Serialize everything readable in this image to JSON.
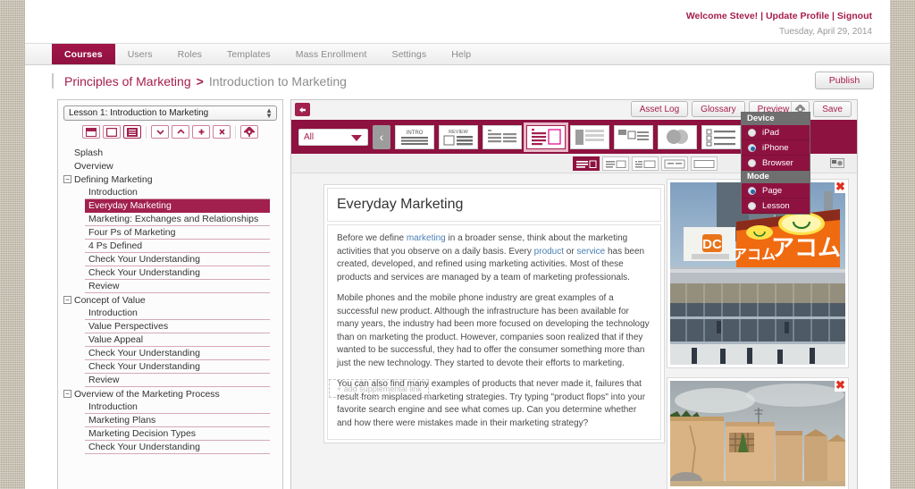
{
  "header": {
    "welcome": "Welcome Steve!",
    "update_profile": "Update Profile",
    "signout": "Signout",
    "sep": " | ",
    "date": "Tuesday, April 29, 2014"
  },
  "nav": {
    "tabs": [
      {
        "label": "Courses",
        "active": true
      },
      {
        "label": "Users",
        "active": false
      },
      {
        "label": "Roles",
        "active": false
      },
      {
        "label": "Templates",
        "active": false
      },
      {
        "label": "Mass Enrollment",
        "active": false
      },
      {
        "label": "Settings",
        "active": false
      },
      {
        "label": "Help",
        "active": false
      }
    ]
  },
  "breadcrumb": {
    "course": "Principles of Marketing",
    "separator": ">",
    "lesson": "Introduction to Marketing",
    "publish_label": "Publish"
  },
  "tree": {
    "lesson_select": "Lesson 1: Introduction to Marketing",
    "tools": [
      {
        "name": "page-layout-icon",
        "selected": false
      },
      {
        "name": "blank-page-icon",
        "selected": false
      },
      {
        "name": "content-page-icon",
        "selected": true
      },
      {
        "name": "move-down-icon",
        "selected": false
      },
      {
        "name": "move-up-icon",
        "selected": false
      },
      {
        "name": "add-icon",
        "selected": false
      },
      {
        "name": "delete-icon",
        "selected": false
      },
      {
        "name": "settings-gear-icon",
        "selected": false
      }
    ],
    "nodes": [
      {
        "label": "Splash",
        "level": 0,
        "group": false,
        "selected": false
      },
      {
        "label": "Overview",
        "level": 0,
        "group": false,
        "selected": false
      },
      {
        "label": "Defining Marketing",
        "level": 0,
        "group": true,
        "selected": false
      },
      {
        "label": "Introduction",
        "level": 1,
        "group": false,
        "selected": false
      },
      {
        "label": "Everyday Marketing",
        "level": 1,
        "group": false,
        "selected": true
      },
      {
        "label": "Marketing: Exchanges and Relationships",
        "level": 1,
        "group": false,
        "selected": false
      },
      {
        "label": "Four Ps of Marketing",
        "level": 1,
        "group": false,
        "selected": false
      },
      {
        "label": "4 Ps Defined",
        "level": 1,
        "group": false,
        "selected": false
      },
      {
        "label": "Check Your Understanding",
        "level": 1,
        "group": false,
        "selected": false
      },
      {
        "label": "Check Your Understanding",
        "level": 1,
        "group": false,
        "selected": false
      },
      {
        "label": "Review",
        "level": 1,
        "group": false,
        "selected": false
      },
      {
        "label": "Concept of Value",
        "level": 0,
        "group": true,
        "selected": false
      },
      {
        "label": "Introduction",
        "level": 1,
        "group": false,
        "selected": false
      },
      {
        "label": "Value Perspectives",
        "level": 1,
        "group": false,
        "selected": false
      },
      {
        "label": "Value Appeal",
        "level": 1,
        "group": false,
        "selected": false
      },
      {
        "label": "Check Your Understanding",
        "level": 1,
        "group": false,
        "selected": false
      },
      {
        "label": "Check Your Understanding",
        "level": 1,
        "group": false,
        "selected": false
      },
      {
        "label": "Review",
        "level": 1,
        "group": false,
        "selected": false
      },
      {
        "label": "Overview of the Marketing Process",
        "level": 0,
        "group": true,
        "selected": false
      },
      {
        "label": "Introduction",
        "level": 1,
        "group": false,
        "selected": false
      },
      {
        "label": "Marketing Plans",
        "level": 1,
        "group": false,
        "selected": false
      },
      {
        "label": "Marketing Decision Types",
        "level": 1,
        "group": false,
        "selected": false
      },
      {
        "label": "Check Your Understanding",
        "level": 1,
        "group": false,
        "selected": false
      }
    ]
  },
  "editor": {
    "actions": {
      "asset_log": "Asset Log",
      "glossary": "Glossary",
      "preview": "Preview",
      "save": "Save"
    },
    "filter_value": "All",
    "templates": [
      {
        "name": "template-intro",
        "label": "INTRO",
        "selected": false
      },
      {
        "name": "template-review",
        "label": "REVIEW",
        "selected": false
      },
      {
        "name": "template-two-column-text",
        "label": "",
        "selected": false
      },
      {
        "name": "template-text-image",
        "label": "",
        "selected": true
      },
      {
        "name": "template-sidebar",
        "label": "",
        "selected": false
      },
      {
        "name": "template-image-text-list",
        "label": "",
        "selected": false
      },
      {
        "name": "template-venn",
        "label": "",
        "selected": false
      },
      {
        "name": "template-checklist",
        "label": "",
        "selected": false
      },
      {
        "name": "template-audio",
        "label": "",
        "selected": false
      }
    ],
    "sub_layouts": [
      {
        "name": "layout-text-left-image-right",
        "selected": true
      },
      {
        "name": "layout-text-box",
        "selected": false
      },
      {
        "name": "layout-title-box",
        "selected": false
      },
      {
        "name": "layout-split-line",
        "selected": false
      },
      {
        "name": "layout-full-box",
        "selected": false
      }
    ]
  },
  "flyout": {
    "device_header": "Device",
    "mode_header": "Mode",
    "device_options": [
      {
        "label": "iPad",
        "selected": false
      },
      {
        "label": "iPhone",
        "selected": true
      },
      {
        "label": "Browser",
        "selected": false
      }
    ],
    "mode_options": [
      {
        "label": "Page",
        "selected": true
      },
      {
        "label": "Lesson",
        "selected": false
      }
    ]
  },
  "page": {
    "title": "Everyday Marketing",
    "paragraphs": [
      {
        "parts": [
          {
            "t": "Before we define ",
            "link": false
          },
          {
            "t": "marketing",
            "link": true
          },
          {
            "t": " in a broader sense, think about the marketing activities that you observe on a daily basis. Every ",
            "link": false
          },
          {
            "t": "product",
            "link": true
          },
          {
            "t": " or ",
            "link": false
          },
          {
            "t": "service",
            "link": true
          },
          {
            "t": " has been created, developed, and refined using marketing activities. Most of these products and services are managed by a team of marketing professionals.",
            "link": false
          }
        ]
      },
      {
        "parts": [
          {
            "t": "Mobile phones and the mobile phone industry are great examples of a successful new product. Although the infrastructure has been available for many years, the industry had been more focused on developing the technology than on marketing the product. However, companies soon realized that if they wanted to be successful, they had to offer the consumer something more than just the new technology. They started to devote their efforts to marketing.",
            "link": false
          }
        ]
      },
      {
        "parts": [
          {
            "t": "You can also find many examples of products that never made it, failures that result from misplaced marketing strategies. Try typing \"product flops\" into your favorite search engine and see what comes up. Can you determine whether and how there were mistakes made in their marketing strategy?",
            "link": false
          }
        ]
      }
    ],
    "supplemental_link_label": "+ add supplemental link",
    "images": [
      {
        "name": "image-japanese-storefront",
        "alt_signs": [
          "アコム",
          "DC"
        ]
      },
      {
        "name": "image-adobe-building",
        "alt_signs": []
      }
    ]
  },
  "colors": {
    "brand": "#8e1240",
    "brand_light": "#a1204e",
    "accent_link": "#4a7fb5",
    "selected_blue": "#2c66a8"
  }
}
